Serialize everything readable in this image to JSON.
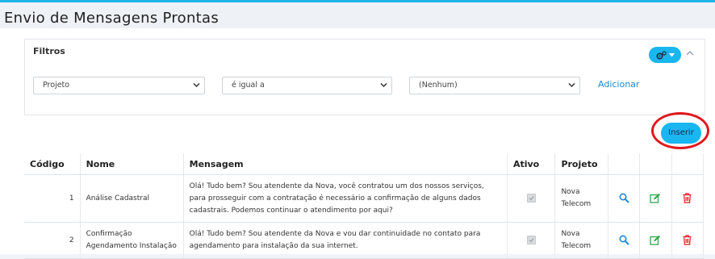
{
  "page": {
    "title": "Envio de Mensagens Prontas"
  },
  "filters": {
    "title": "Filtros",
    "settings_icon": "gears-icon",
    "selects": [
      {
        "value": "Projeto"
      },
      {
        "value": "é igual a"
      },
      {
        "value": "(Nenhum)"
      }
    ],
    "add_label": "Adicionar"
  },
  "toolbar": {
    "insert_label": "Inserir"
  },
  "table": {
    "columns": [
      "Código",
      "Nome",
      "Mensagem",
      "Ativo",
      "Projeto"
    ],
    "rows": [
      {
        "code": "1",
        "name": "Análise Cadastral",
        "message": "Olá! Tudo bem? Sou atendente da Nova, você contratou um dos nossos serviços, para prosseguir com a contratação é necessário a confirmação de alguns dados cadastrais. Podemos continuar o atendimento por aqui?",
        "active": true,
        "project": "Nova Telecom"
      },
      {
        "code": "2",
        "name": "Confirmação Agendamento Instalação",
        "message": "Olá! Tudo bem? Sou atendente da Nova e vou dar continuidade no contato para agendamento para instalação da sua internet.",
        "active": true,
        "project": "Nova Telecom"
      }
    ]
  },
  "colors": {
    "accent": "#19b6f0",
    "link": "#1a8ad4",
    "view_icon": "#1a8ad4",
    "edit_icon": "#2ea84a",
    "delete_icon": "#e0191e",
    "highlight_circle": "#e0191e"
  }
}
